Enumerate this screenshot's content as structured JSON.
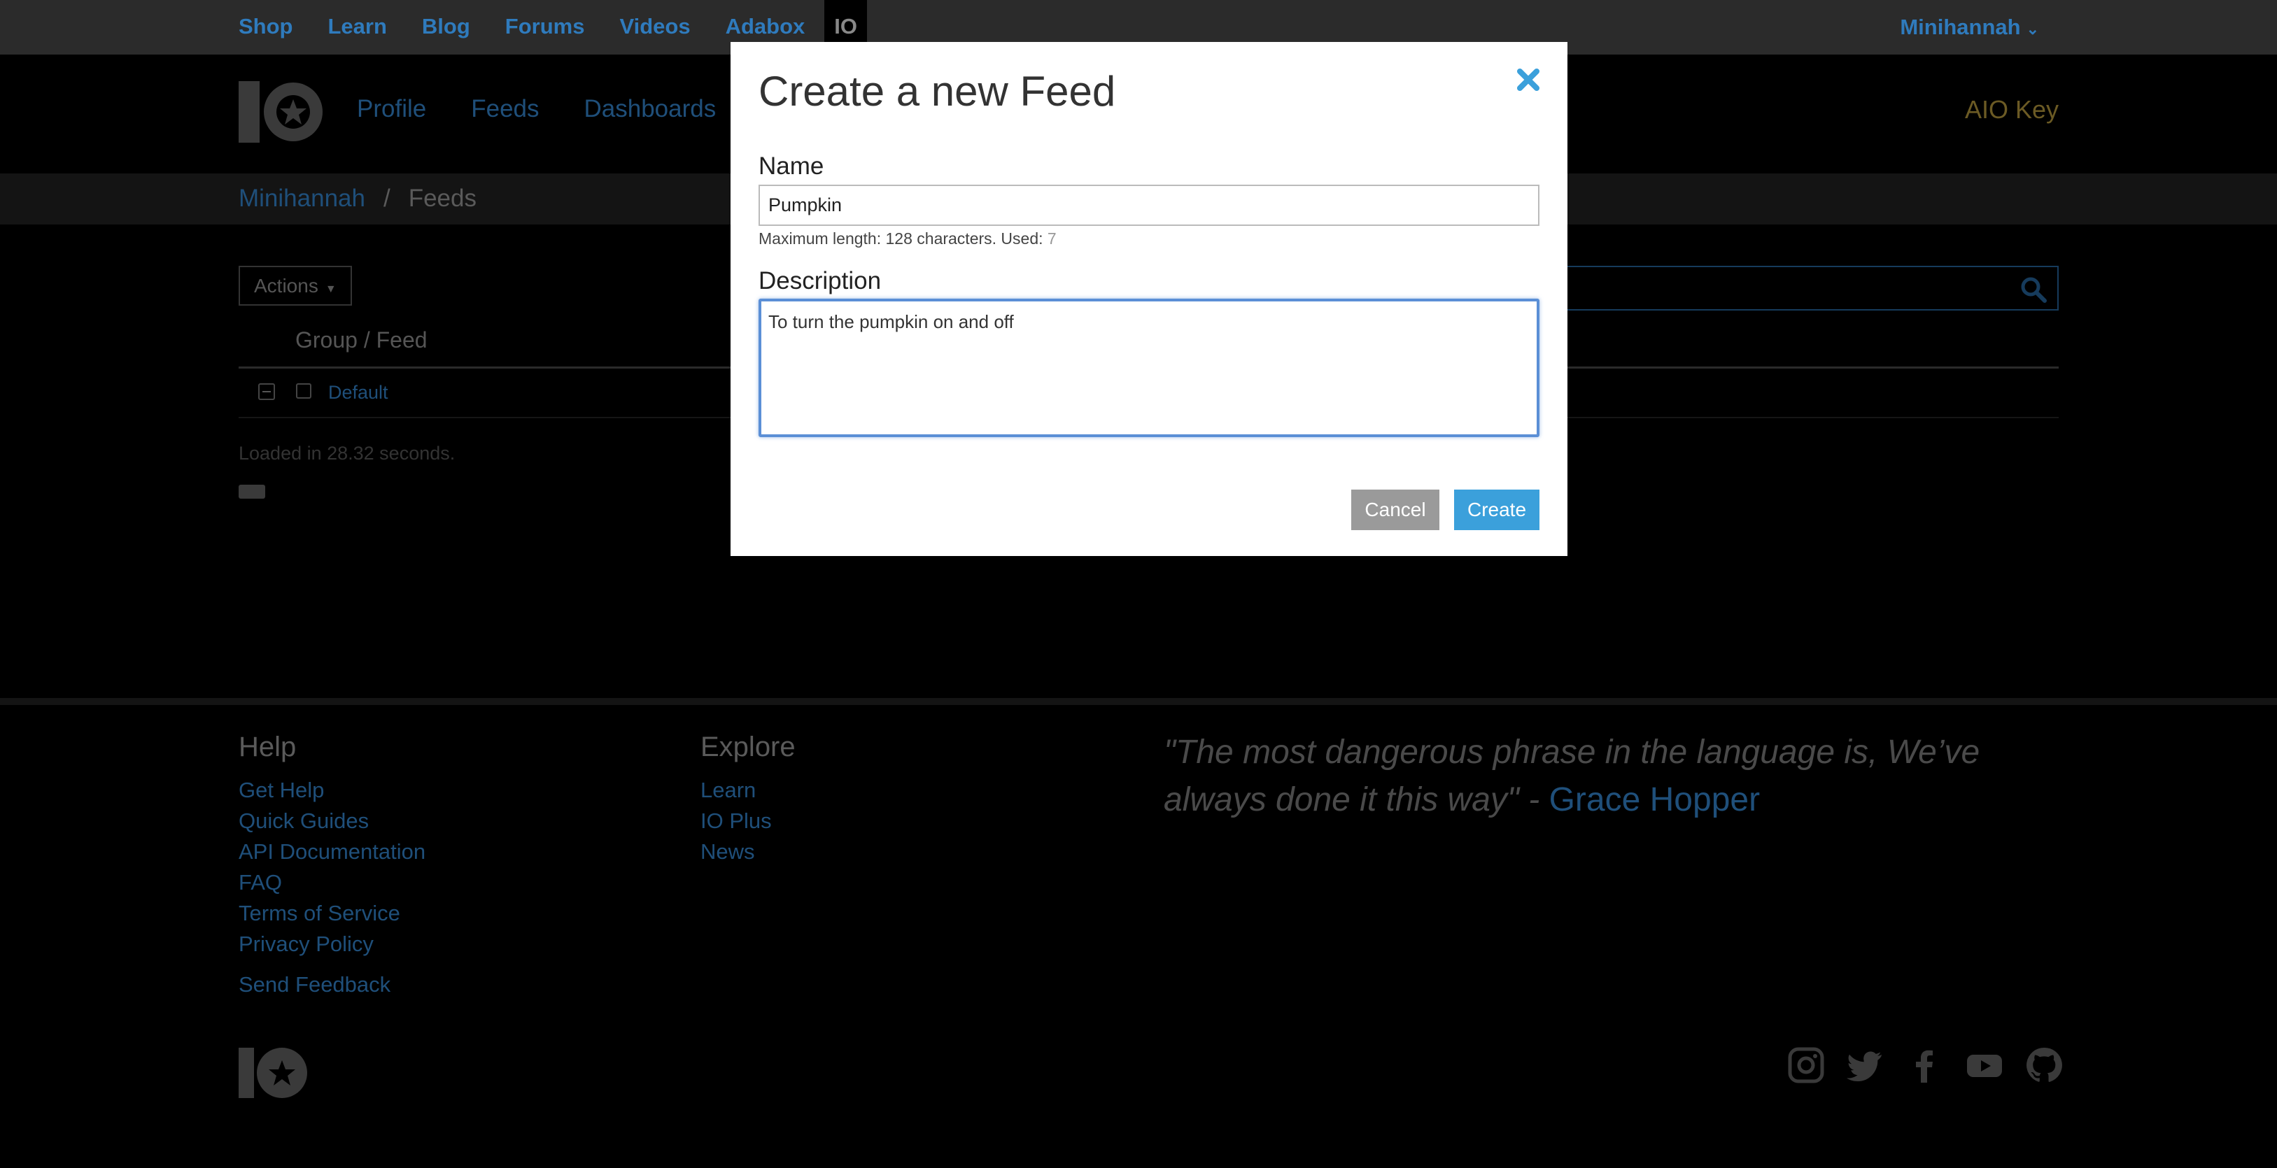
{
  "topnav": {
    "items": [
      {
        "label": "Shop"
      },
      {
        "label": "Learn"
      },
      {
        "label": "Blog"
      },
      {
        "label": "Forums"
      },
      {
        "label": "Videos"
      },
      {
        "label": "Adabox"
      },
      {
        "label": "IO"
      }
    ],
    "user": "Minihannah"
  },
  "mainnav": {
    "items": [
      {
        "label": "Profile"
      },
      {
        "label": "Feeds"
      },
      {
        "label": "Dashboards"
      }
    ],
    "aio_key": "AIO Key"
  },
  "breadcrumb": {
    "user": "Minihannah",
    "separator": "/",
    "current": "Feeds"
  },
  "content": {
    "actions_label": "Actions",
    "column_header": "Group / Feed",
    "group_name": "Default",
    "loaded_text": "Loaded in 28.32 seconds."
  },
  "footer": {
    "help_title": "Help",
    "help_links": [
      {
        "label": "Get Help"
      },
      {
        "label": "Quick Guides"
      },
      {
        "label": "API Documentation"
      },
      {
        "label": "FAQ"
      },
      {
        "label": "Terms of Service"
      },
      {
        "label": "Privacy Policy"
      }
    ],
    "send_feedback": "Send Feedback",
    "explore_title": "Explore",
    "explore_links": [
      {
        "label": "Learn"
      },
      {
        "label": "IO Plus"
      },
      {
        "label": "News"
      }
    ],
    "quote_text": "\"The most dangerous phrase in the language is, We’ve always done it this way\" - ",
    "quote_author": "Grace Hopper"
  },
  "modal": {
    "title": "Create a new Feed",
    "name_label": "Name",
    "name_value": "Pumpkin",
    "hint_text": "Maximum length: 128 characters. Used: ",
    "hint_used": "7",
    "description_label": "Description",
    "description_value": "To turn the pumpkin on and off",
    "cancel_label": "Cancel",
    "create_label": "Create"
  },
  "colors": {
    "link_blue": "#2f7bbd",
    "create_blue": "#3ba0db",
    "focus_blue": "#5b8fd6",
    "aio_gold": "#c9a63f"
  },
  "icons": [
    "close-icon",
    "search-icon",
    "instagram-icon",
    "twitter-icon",
    "facebook-icon",
    "youtube-icon",
    "github-icon"
  ]
}
